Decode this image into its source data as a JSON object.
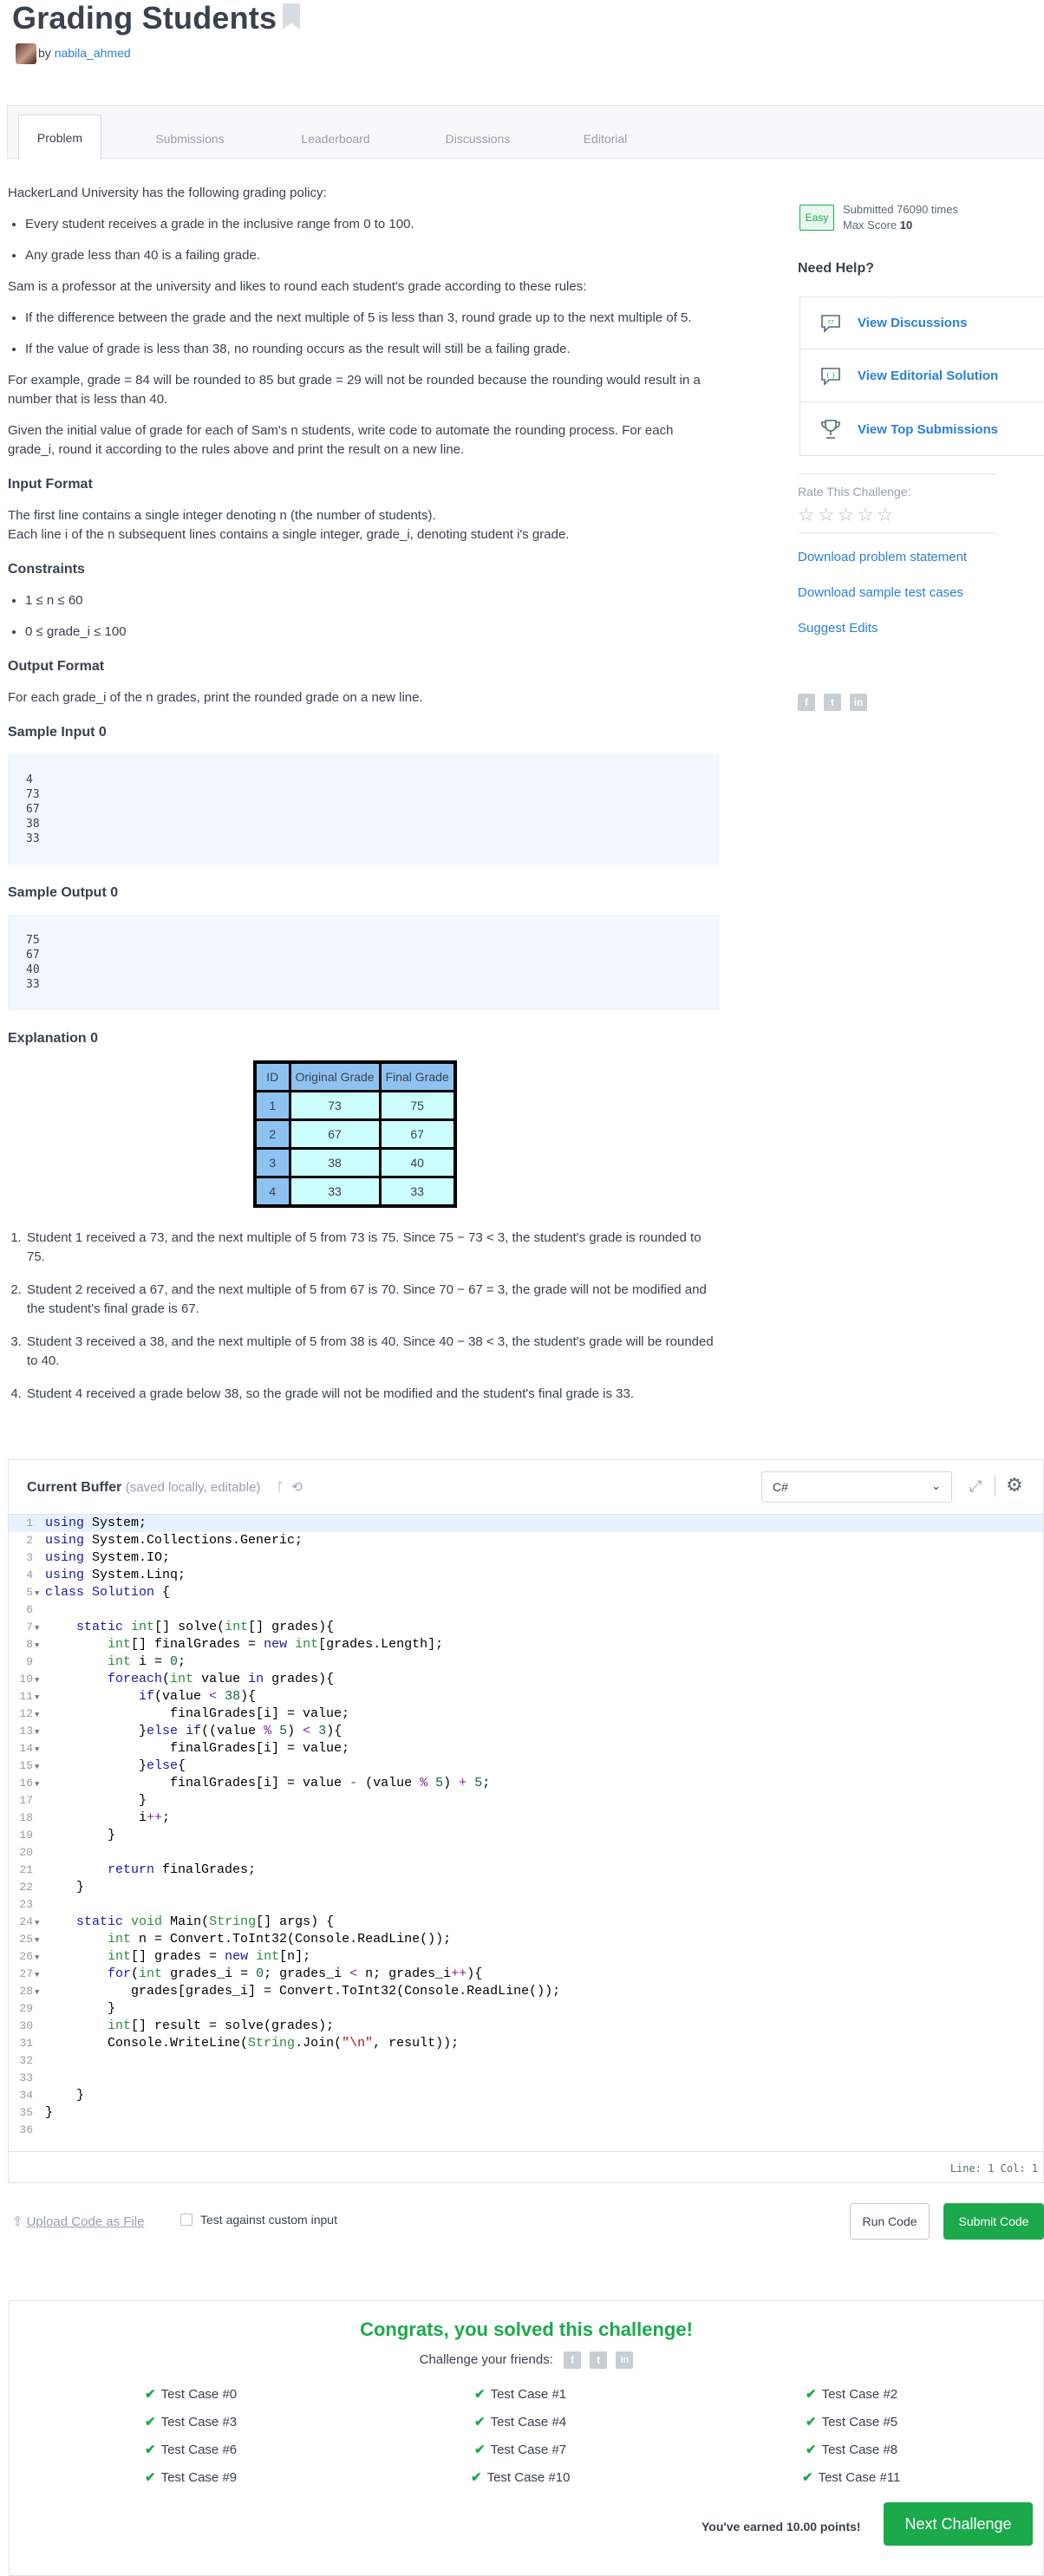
{
  "page": {
    "title": "Grading Students",
    "by": "by",
    "author": "nabila_ahmed"
  },
  "tabs": [
    "Problem",
    "Submissions",
    "Leaderboard",
    "Discussions",
    "Editorial"
  ],
  "problem": {
    "intro": "HackerLand University has the following grading policy:",
    "policy": [
      "Every student receives a grade in the inclusive range from 0 to 100.",
      "Any grade less than 40 is a failing grade."
    ],
    "rules_intro": "Sam is a professor at the university and likes to round each student's grade according to these rules:",
    "rules": [
      "If the difference between the grade and the next multiple of 5 is less than 3, round grade up to the next multiple of 5.",
      "If the value of grade is less than 38, no rounding occurs as the result will still be a failing grade."
    ],
    "example": "For example, grade = 84 will be rounded to 85 but grade = 29 will not be rounded because the rounding would result in a number that is less than 40.",
    "task": "Given the initial value of grade for each of Sam's n students, write code to automate the rounding process. For each grade_i, round it according to the rules above and print the result on a new line.",
    "input_heading": "Input Format",
    "input_1": "The first line contains a single integer denoting n (the number of students).",
    "input_2": "Each line i of the n subsequent lines contains a single integer, grade_i, denoting student i's grade.",
    "constraints_heading": "Constraints",
    "constraints": [
      "1 ≤ n ≤ 60",
      "0 ≤ grade_i ≤ 100"
    ],
    "output_heading": "Output Format",
    "output": "For each grade_i of the n grades, print the rounded grade on a new line.",
    "sample_input_heading": "Sample Input 0",
    "sample_input": "4\n73\n67\n38\n33",
    "sample_output_heading": "Sample Output 0",
    "sample_output": "75\n67\n40\n33",
    "explanation_heading": "Explanation 0",
    "table": {
      "headers": [
        "ID",
        "Original Grade",
        "Final Grade"
      ],
      "rows": [
        [
          "1",
          "73",
          "75"
        ],
        [
          "2",
          "67",
          "67"
        ],
        [
          "3",
          "38",
          "40"
        ],
        [
          "4",
          "33",
          "33"
        ]
      ]
    },
    "explanation": [
      "Student 1 received a 73, and the next multiple of 5 from 73 is 75. Since 75 − 73 < 3, the student's grade is rounded to 75.",
      "Student 2 received a 67, and the next multiple of 5 from 67 is 70. Since 70 − 67 = 3, the grade will not be modified and the student's final grade is 67.",
      "Student 3 received a 38, and the next multiple of 5 from 38 is 40. Since 40 − 38 < 3, the student's grade will be rounded to 40.",
      "Student 4 received a grade below 38, so the grade will not be modified and the student's final grade is 33."
    ]
  },
  "sidebar": {
    "difficulty": "Easy",
    "submitted": "Submitted 76090 times",
    "max_score_label": "Max Score",
    "max_score": "10",
    "need_help": "Need Help?",
    "help_items": [
      "View Discussions",
      "View Editorial Solution",
      "View Top Submissions"
    ],
    "rate": "Rate This Challenge:",
    "links": [
      "Download problem statement",
      "Download sample test cases",
      "Suggest Edits"
    ]
  },
  "editor": {
    "title": "Current Buffer",
    "subtitle": "(saved locally, editable)",
    "language": "C#",
    "position": "Line: 1 Col: 1"
  },
  "actions": {
    "upload": "Upload Code as File",
    "custom_input": "Test against custom input",
    "run": "Run Code",
    "submit": "Submit Code"
  },
  "result": {
    "title": "Congrats, you solved this challenge!",
    "challenge_friends": "Challenge your friends:",
    "test_cases": [
      "Test Case #0",
      "Test Case #1",
      "Test Case #2",
      "Test Case #3",
      "Test Case #4",
      "Test Case #5",
      "Test Case #6",
      "Test Case #7",
      "Test Case #8",
      "Test Case #9",
      "Test Case #10",
      "Test Case #11"
    ],
    "earned": "You've earned 10.00 points!",
    "next": "Next Challenge"
  },
  "colors": {
    "accent_green": "#1ba94c",
    "link_blue": "#2b7fd4",
    "text": "#39424e"
  }
}
